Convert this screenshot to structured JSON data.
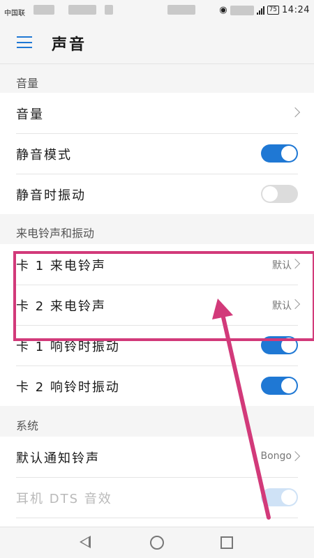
{
  "status_bar": {
    "carrier": "中国联",
    "battery": "75",
    "time": "14:24"
  },
  "app_bar": {
    "title": "声音",
    "menu_icon": "hamburger-menu-icon"
  },
  "sections": {
    "volume": {
      "header": "音量",
      "volume_row": {
        "label": "音量"
      },
      "silent_mode": {
        "label": "静音模式",
        "enabled": true
      },
      "vibrate_when_silent": {
        "label": "静音时振动",
        "enabled": false
      }
    },
    "ringtone": {
      "header": "来电铃声和振动",
      "sim1_ringtone": {
        "label": "卡 1 来电铃声",
        "value": "默认"
      },
      "sim2_ringtone": {
        "label": "卡 2 来电铃声",
        "value": "默认"
      },
      "sim1_vibrate": {
        "label": "卡 1 响铃时振动",
        "enabled": true
      },
      "sim2_vibrate": {
        "label": "卡 2 响铃时振动",
        "enabled": true
      }
    },
    "system": {
      "header": "系统",
      "notification_tone": {
        "label": "默认通知铃声",
        "value": "Bongo"
      },
      "dts_effect": {
        "label": "耳机 DTS 音效",
        "enabled": true,
        "disabled": true
      }
    }
  },
  "nav_bar": {
    "back_icon": "back-triangle-icon",
    "home_icon": "home-circle-icon",
    "recent_icon": "recent-square-icon"
  },
  "colors": {
    "accent": "#1f78d4",
    "annotation": "#d23a7a",
    "background": "#f5f5f5",
    "panel": "#ffffff"
  }
}
